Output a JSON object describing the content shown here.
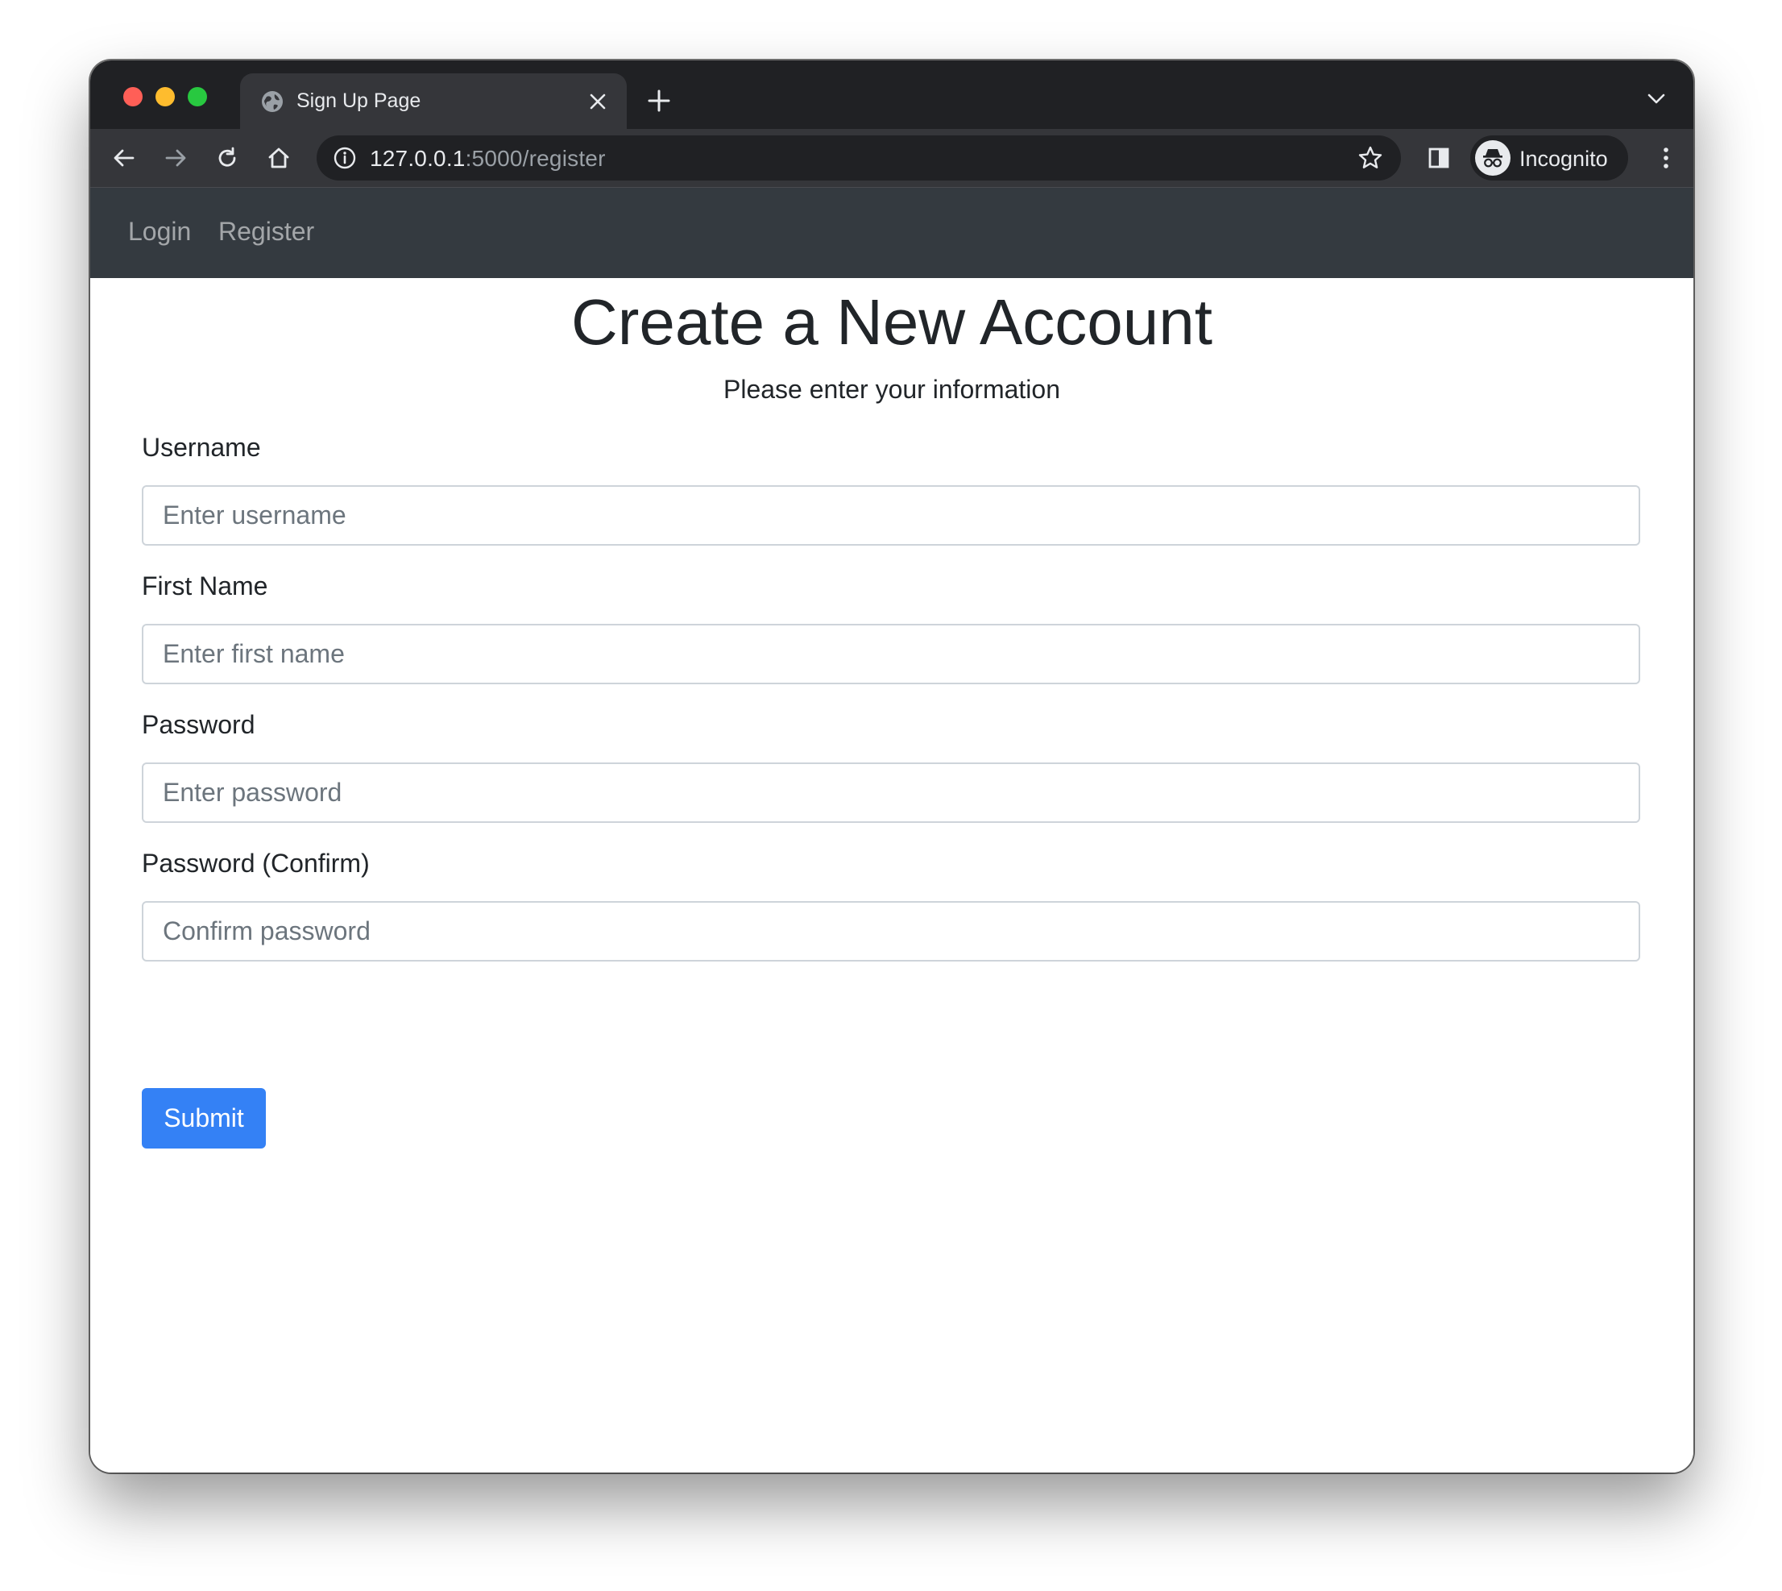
{
  "browser": {
    "tab_title": "Sign Up Page",
    "url_host": "127.0.0.1",
    "url_path": ":5000/register",
    "profile_label": "Incognito"
  },
  "navbar": {
    "links": [
      {
        "label": "Login"
      },
      {
        "label": "Register"
      }
    ]
  },
  "page": {
    "title": "Create a New Account",
    "subtitle": "Please enter your information"
  },
  "form": {
    "fields": [
      {
        "label": "Username",
        "placeholder": "Enter username",
        "value": ""
      },
      {
        "label": "First Name",
        "placeholder": "Enter first name",
        "value": ""
      },
      {
        "label": "Password",
        "placeholder": "Enter password",
        "value": ""
      },
      {
        "label": "Password (Confirm)",
        "placeholder": "Confirm password",
        "value": ""
      }
    ],
    "submit_label": "Submit"
  },
  "colors": {
    "navbar_bg": "#343a40",
    "submit_bg": "#3481f5",
    "browser_frame": "#202124"
  },
  "icons": [
    "globe-icon",
    "close-icon",
    "plus-icon",
    "chevron-down-icon",
    "back-arrow-icon",
    "forward-arrow-icon",
    "reload-icon",
    "home-icon",
    "info-icon",
    "star-icon",
    "side-panel-icon",
    "incognito-icon",
    "more-vertical-icon"
  ]
}
